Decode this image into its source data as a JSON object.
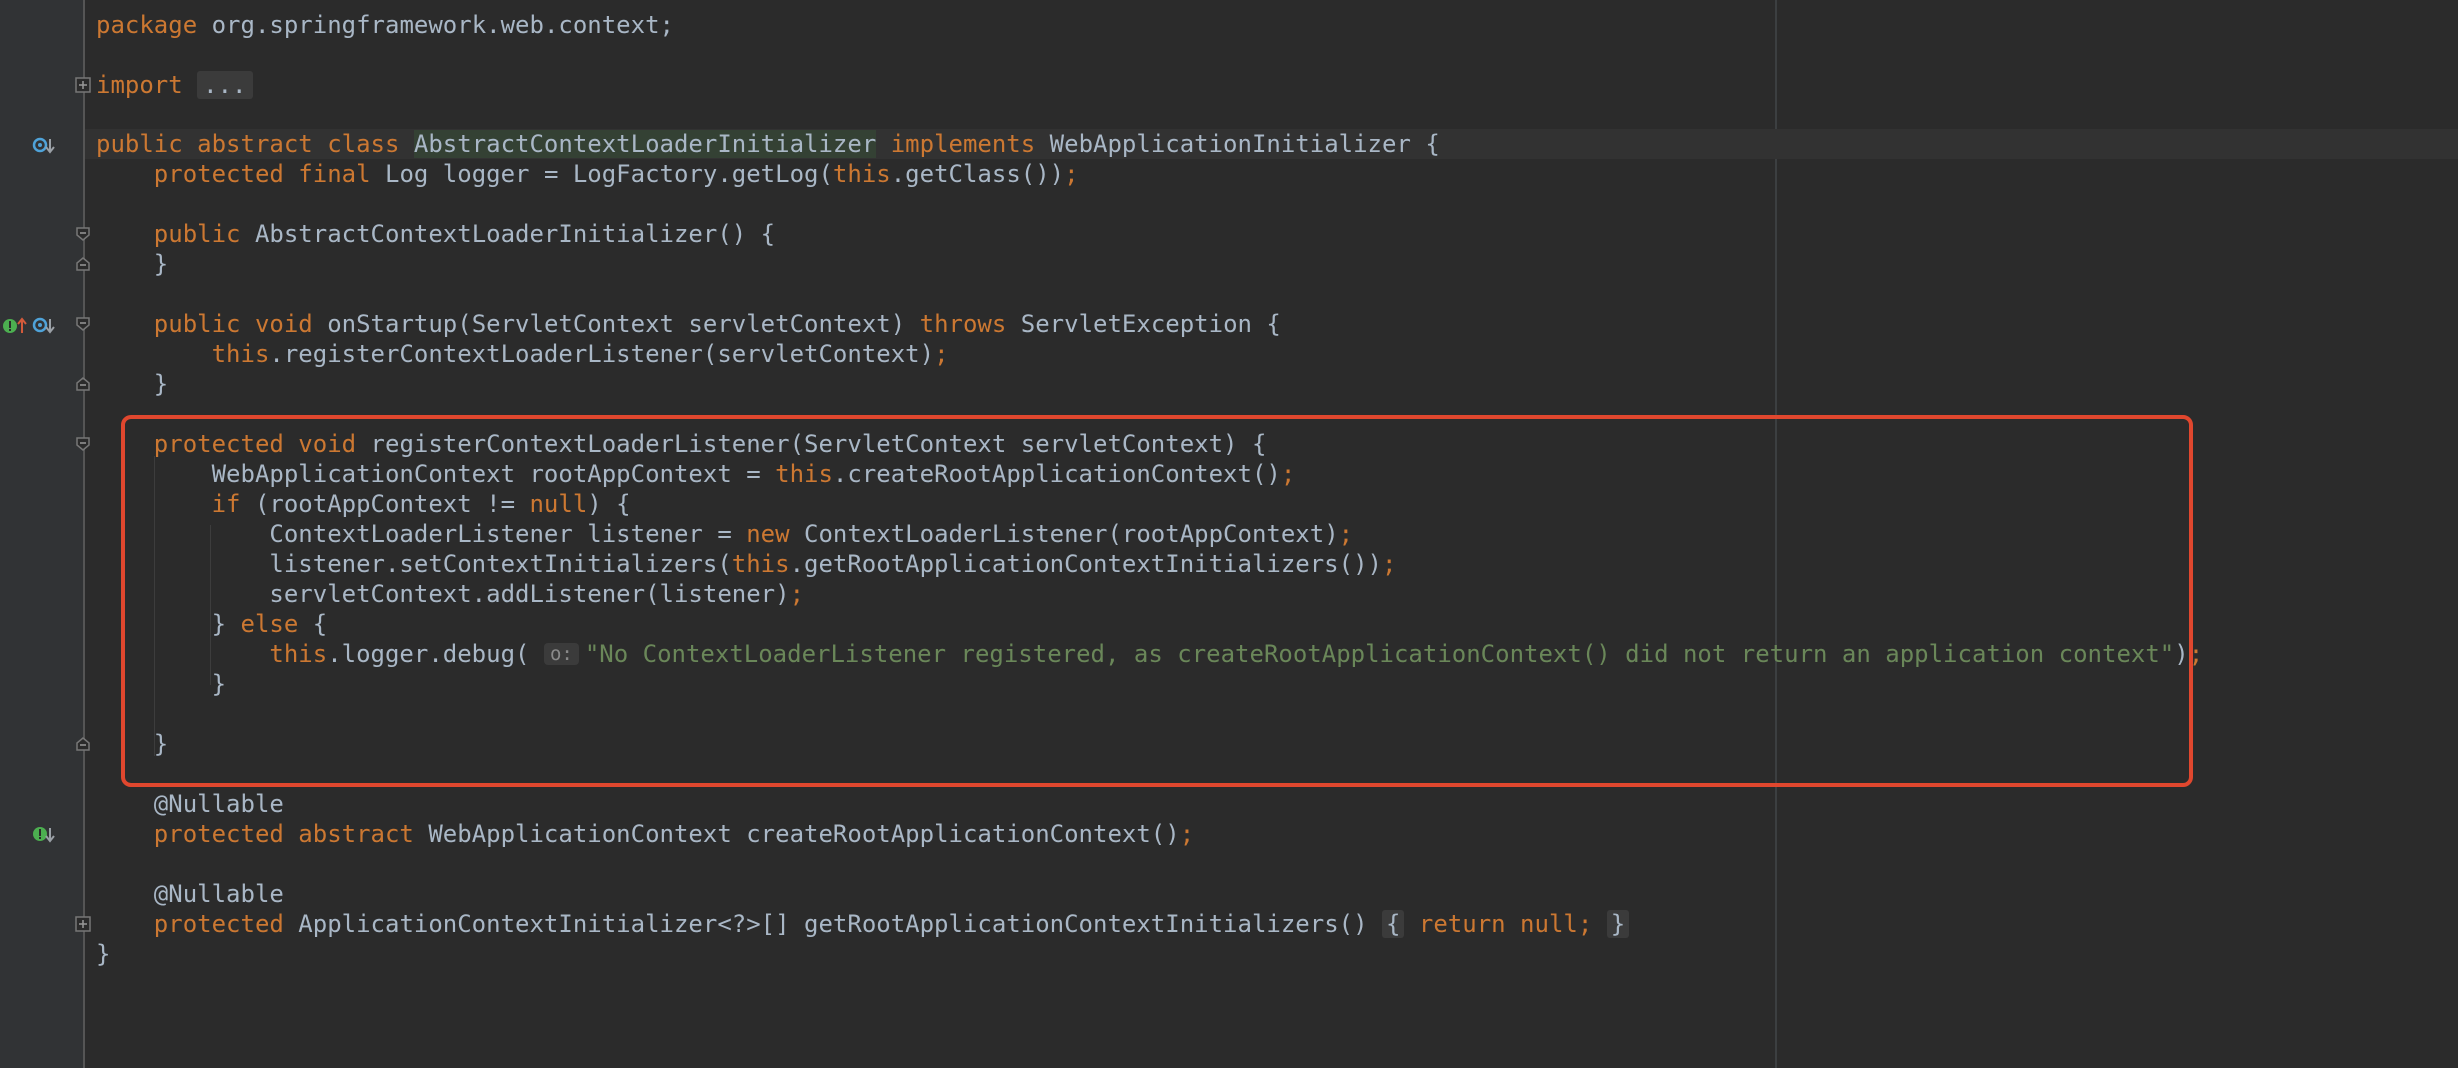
{
  "editor": {
    "language": "Java",
    "lines": {
      "l1_kw": "package",
      "l1_rest": " org.springframework.web.context;",
      "l3_kw": "import",
      "l3_fold": "...",
      "l5_kw": "public abstract class ",
      "l5_name": "AbstractContextLoaderInitializer",
      "l5_kw2": " implements",
      "l5_rest": " WebApplicationInitializer {",
      "l6_kw": "    protected final",
      "l6_a": " Log logger = LogFactory.getLog(",
      "l6_this": "this",
      "l6_b": ".getClass())",
      "l6_semi": ";",
      "l8_kw": "    public",
      "l8_rest": " AbstractContextLoaderInitializer() {",
      "l9": "    }",
      "l11_kw": "    public void",
      "l11_a": " onStartup(ServletContext servletContext) ",
      "l11_throws": "throws",
      "l11_b": " ServletException {",
      "l12_this": "        this",
      "l12_a": ".registerContextLoaderListener(servletContext)",
      "l12_semi": ";",
      "l13": "    }",
      "l15_kw": "    protected void",
      "l15_rest": " registerContextLoaderListener(ServletContext servletContext) {",
      "l16_a": "        WebApplicationContext rootAppContext = ",
      "l16_this": "this",
      "l16_b": ".createRootApplicationContext()",
      "l16_semi": ";",
      "l17_if": "        if",
      "l17_a": " (rootAppContext != ",
      "l17_null": "null",
      "l17_b": ") {",
      "l18_a": "            ContextLoaderListener listener = ",
      "l18_new": "new",
      "l18_b": " ContextLoaderListener(rootAppContext)",
      "l18_semi": ";",
      "l19_a": "            listener.setContextInitializers(",
      "l19_this": "this",
      "l19_b": ".getRootApplicationContextInitializers())",
      "l19_semi": ";",
      "l20_a": "            servletContext.addListener(listener)",
      "l20_semi": ";",
      "l21_a": "        } ",
      "l21_else": "else",
      "l21_b": " {",
      "l22_this": "            this",
      "l22_a": ".logger.debug( ",
      "l22_hint": "o:",
      "l22_str": "\"No ContextLoaderListener registered, as createRootApplicationContext() did not return an application context\"",
      "l22_b": ")",
      "l22_semi": ";",
      "l23": "        }",
      "l25": "    }",
      "l26_ann": "    @Nullable",
      "l27_kw": "    protected abstract",
      "l27_a": " WebApplicationContext createRootApplicationContext()",
      "l27_semi": ";",
      "l29_ann": "    @Nullable",
      "l30_kw": "    protected",
      "l30_a": " ApplicationContextInitializer<?>[] getRootApplicationContextInitializers()",
      "l30_fold_open": "{",
      "l30_ret": "return null;",
      "l30_fold_close": "}",
      "l31": "}"
    }
  },
  "colors": {
    "background": "#2b2b2b",
    "gutter": "#313335",
    "keyword": "#cc7832",
    "string": "#6a8759",
    "text": "#a9b7c6",
    "highlight_box": "#e0472e"
  },
  "icons": {
    "override_marker": "override-icon",
    "implement_marker": "implement-icon",
    "fold_marker": "fold-icon"
  }
}
